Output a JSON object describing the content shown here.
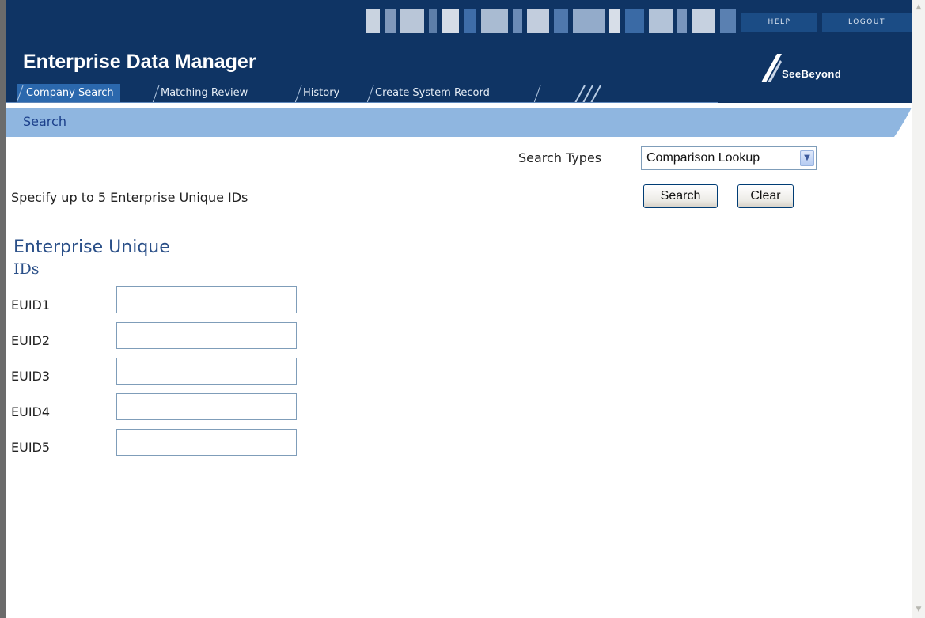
{
  "header": {
    "app_title": "Enterprise Data Manager",
    "help_label": "HELP",
    "logout_label": "LOGOUT",
    "logo_text": "SeeBeyond",
    "tabs": [
      {
        "label": "Company Search",
        "active": true
      },
      {
        "label": "Matching Review",
        "active": false
      },
      {
        "label": "History",
        "active": false
      },
      {
        "label": "Create System Record",
        "active": false
      }
    ]
  },
  "subbar": {
    "label": "Search"
  },
  "search": {
    "types_label": "Search Types",
    "types_value": "Comparison Lookup",
    "instruction": "Specify up to 5 Enterprise Unique IDs",
    "search_button": "Search",
    "clear_button": "Clear"
  },
  "section": {
    "title_line1": "Enterprise Unique",
    "title_line2": "IDs",
    "fields": [
      {
        "label": "EUID1",
        "value": ""
      },
      {
        "label": "EUID2",
        "value": ""
      },
      {
        "label": "EUID3",
        "value": ""
      },
      {
        "label": "EUID4",
        "value": ""
      },
      {
        "label": "EUID5",
        "value": ""
      }
    ]
  },
  "colors": {
    "header_bg": "#0f3464",
    "active_tab": "#2b68ad",
    "subbar_bg": "#8fb6e0",
    "section_title": "#2a4f88"
  }
}
